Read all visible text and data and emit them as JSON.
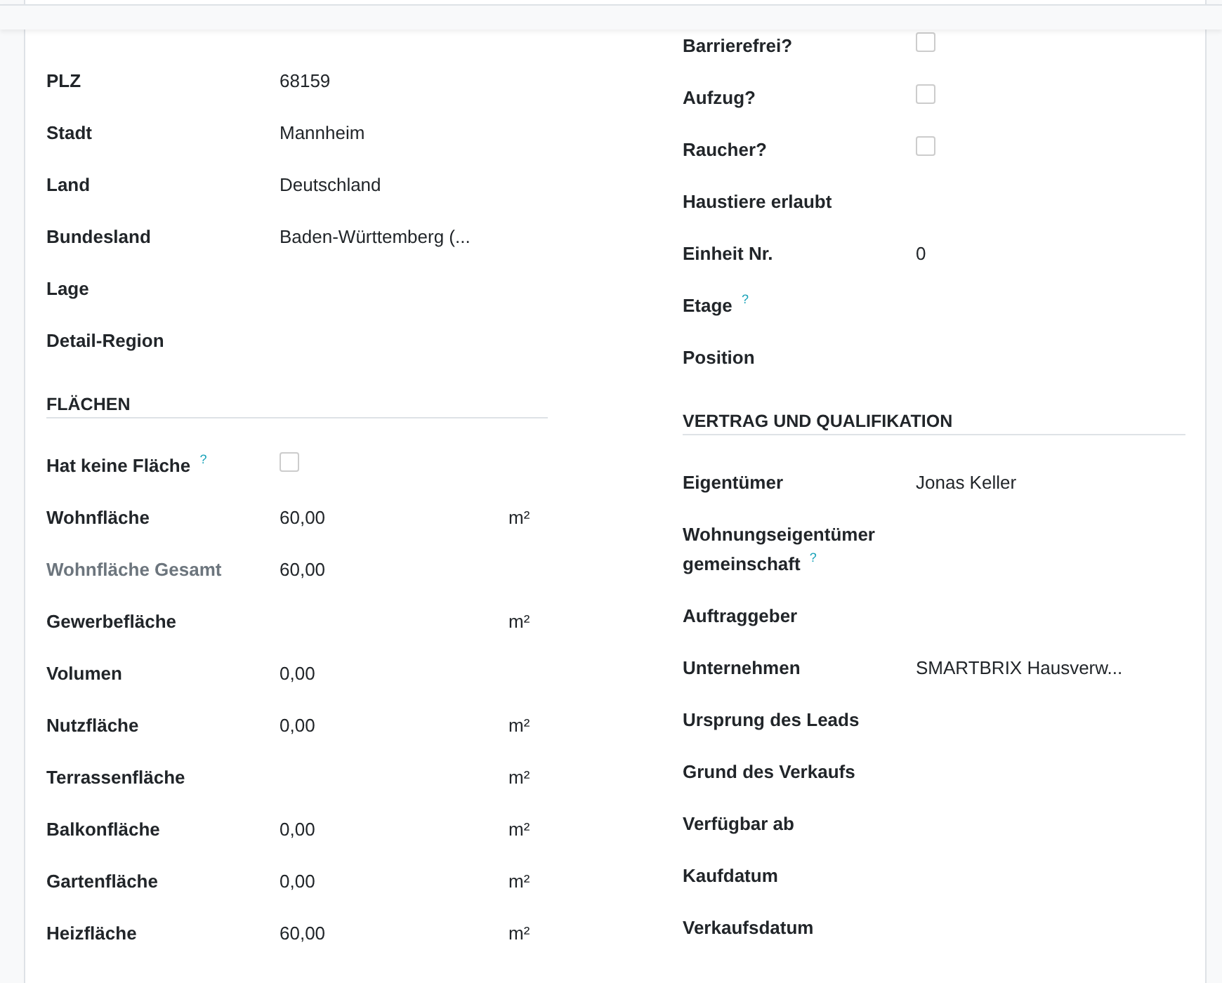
{
  "left": {
    "fields": [
      {
        "label": "PLZ",
        "value": "68159"
      },
      {
        "label": "Stadt",
        "value": "Mannheim"
      },
      {
        "label": "Land",
        "value": "Deutschland"
      },
      {
        "label": "Bundesland",
        "value": "Baden-Württemberg (..."
      },
      {
        "label": "Lage"
      },
      {
        "label": "Detail-Region"
      }
    ],
    "section": {
      "title": "FLÄCHEN",
      "fields": [
        {
          "kind": "checkbox",
          "label": "Hat keine Fläche $^{?}$",
          "checked": false
        },
        {
          "kind": "text",
          "label": "Wohnfläche",
          "value": "60,00",
          "unit": "m²"
        },
        {
          "kind": "text",
          "label": "Wohnfläche Gesamt",
          "value": "60,00",
          "readonly": true
        },
        {
          "kind": "text",
          "label": "Gewerbefläche",
          "unit": "m²"
        },
        {
          "kind": "text",
          "label": "Volumen",
          "value": "0,00"
        },
        {
          "kind": "text",
          "label": "Nutzfläche",
          "value": "0,00",
          "unit": "m²"
        },
        {
          "kind": "text",
          "label": "Terrassenfläche",
          "unit": "m²"
        },
        {
          "kind": "text",
          "label": "Balkonfläche",
          "value": "0,00",
          "unit": "m²"
        },
        {
          "kind": "text",
          "label": "Gartenfläche",
          "value": "0,00",
          "unit": "m²"
        },
        {
          "kind": "text",
          "label": "Heizfläche",
          "value": "60,00",
          "unit": "m²"
        }
      ]
    }
  },
  "right": {
    "fields": [
      {
        "kind": "checkbox",
        "label": "Barrierefrei?",
        "checked": false
      },
      {
        "kind": "checkbox",
        "label": "Aufzug?",
        "checked": false
      },
      {
        "kind": "checkbox",
        "label": "Raucher?",
        "checked": false
      },
      {
        "kind": "text",
        "label": "Haustiere erlaubt"
      },
      {
        "kind": "text",
        "label": "Einheit Nr.",
        "value": "0"
      },
      {
        "kind": "text",
        "label": "Etage $^{?}$"
      },
      {
        "kind": "text",
        "label": "Position"
      }
    ],
    "section": {
      "title": "VERTRAG UND QUALIFIKATION",
      "fields": [
        {
          "label": "Eigentümer",
          "value": "Jonas Keller"
        },
        {
          "label": "Wohnungseigentümer gemeinschaft $^{?}$"
        },
        {
          "label": "Auftraggeber"
        },
        {
          "label": "Unternehmen",
          "value": "SMARTBRIX Hausverw..."
        },
        {
          "label": "Ursprung des Leads"
        },
        {
          "label": "Grund des Verkaufs"
        },
        {
          "label": "Verfügbar ab"
        },
        {
          "label": "Kaufdatum"
        },
        {
          "label": "Verkaufsdatum"
        }
      ]
    }
  }
}
